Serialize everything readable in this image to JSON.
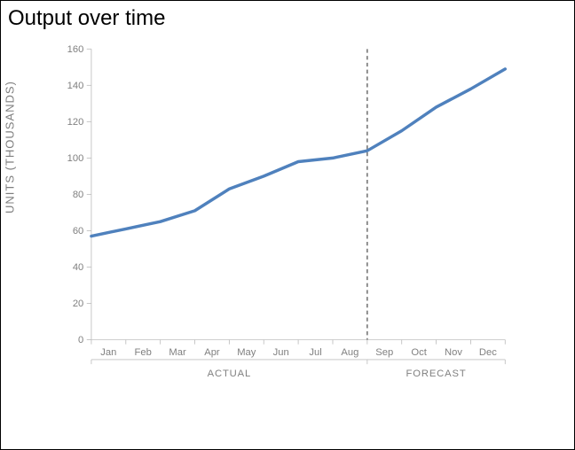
{
  "title": "Output over time",
  "ylabel": "UNITS (THOUSANDS)",
  "chart_data": {
    "type": "line",
    "title": "Output over time",
    "ylabel": "UNITS (THOUSANDS)",
    "ylim": [
      0,
      160
    ],
    "yticks": [
      0,
      20,
      40,
      60,
      80,
      100,
      120,
      140,
      160
    ],
    "categories": [
      "Jan",
      "Feb",
      "Mar",
      "Apr",
      "May",
      "Jun",
      "Jul",
      "Aug",
      "Sep",
      "Oct",
      "Nov",
      "Dec"
    ],
    "values": [
      57,
      61,
      65,
      71,
      83,
      90,
      98,
      100,
      104,
      115,
      128,
      138,
      149
    ],
    "groups": [
      {
        "label": "ACTUAL",
        "start_index": 0,
        "end_index": 7
      },
      {
        "label": "FORECAST",
        "start_index": 8,
        "end_index": 11
      }
    ],
    "divider_after_index": 7,
    "line_color": "#4f81bd"
  }
}
